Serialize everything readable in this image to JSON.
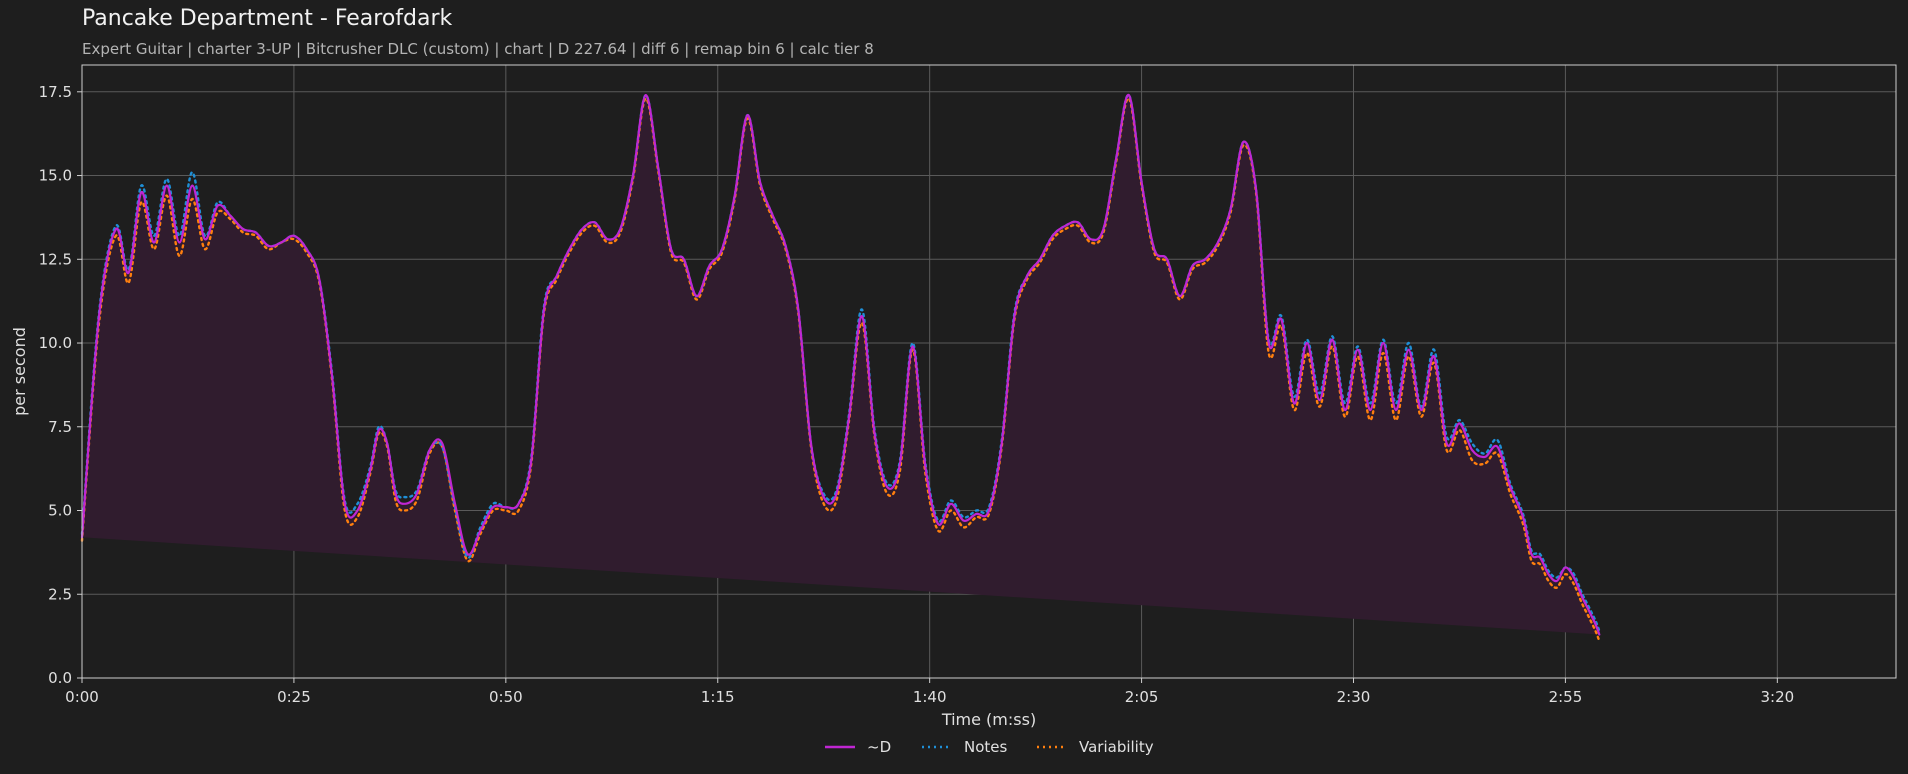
{
  "header": {
    "title": "Pancake Department - Fearofdark",
    "subtitle": "Expert Guitar  |  charter 3-UP  |  Bitcrusher DLC (custom)  |  chart  |  D 227.64  |  diff 6  |  remap bin 6  |  calc tier 8"
  },
  "colors": {
    "background": "#1e1e1e",
    "d_line": "#c026d3",
    "notes_line": "#1f8fd6",
    "variability_line": "#ff7f0e",
    "fill": "#301c2e",
    "grid": "#5a5a5a"
  },
  "chart_data": {
    "type": "line",
    "xlabel": "Time (m:ss)",
    "ylabel": "per second",
    "xlim": [
      0,
      214
    ],
    "ylim": [
      0,
      18.3
    ],
    "grid": true,
    "legend_placement": "bottom-center",
    "x_ticks": [
      {
        "value": 0,
        "label": "0:00"
      },
      {
        "value": 25,
        "label": "0:25"
      },
      {
        "value": 50,
        "label": "0:50"
      },
      {
        "value": 75,
        "label": "1:15"
      },
      {
        "value": 100,
        "label": "1:40"
      },
      {
        "value": 125,
        "label": "2:05"
      },
      {
        "value": 150,
        "label": "2:30"
      },
      {
        "value": 175,
        "label": "2:55"
      },
      {
        "value": 200,
        "label": "3:20"
      }
    ],
    "y_ticks": [
      {
        "value": 0,
        "label": "0.0"
      },
      {
        "value": 2.5,
        "label": "2.5"
      },
      {
        "value": 5,
        "label": "5.0"
      },
      {
        "value": 7.5,
        "label": "7.5"
      },
      {
        "value": 10,
        "label": "10.0"
      },
      {
        "value": 12.5,
        "label": "12.5"
      },
      {
        "value": 15,
        "label": "15.0"
      },
      {
        "value": 17.5,
        "label": "17.5"
      }
    ],
    "x": [
      0,
      2,
      4,
      5.5,
      7,
      8.5,
      10,
      11.5,
      13,
      14.5,
      16,
      17.5,
      19,
      20.5,
      22,
      23.5,
      25,
      26.5,
      28,
      29.5,
      31,
      32.5,
      34,
      35,
      36,
      37,
      38,
      39.5,
      41,
      42.5,
      44,
      45.5,
      47,
      48.5,
      50,
      51.5,
      53,
      54.5,
      56,
      57.5,
      59,
      60.5,
      62,
      63.5,
      65,
      66.5,
      68,
      69.5,
      71,
      72.5,
      74,
      75.5,
      77,
      78.5,
      80,
      81.5,
      83,
      84.5,
      86,
      87.5,
      89,
      90.5,
      92,
      93.5,
      95,
      96.5,
      98,
      99.5,
      101,
      102.5,
      104,
      105.5,
      107,
      108.5,
      110,
      111.5,
      113,
      114.5,
      116,
      117.5,
      119,
      120.5,
      122,
      123.5,
      125,
      126.5,
      128,
      129.5,
      131,
      132.5,
      134,
      135.5,
      137,
      138.5,
      140,
      141.5,
      143,
      144.5,
      146,
      147.5,
      149,
      150.5,
      152,
      153.5,
      155,
      156.5,
      158,
      159.5,
      161,
      162.5,
      164,
      165.5,
      167,
      168.5,
      170,
      171,
      172,
      173,
      174,
      175,
      176,
      177,
      178,
      179,
      180,
      181,
      182,
      183,
      184,
      185,
      186,
      187,
      188,
      189,
      190,
      191,
      192,
      193,
      194,
      195,
      196,
      197,
      198,
      199,
      200,
      201,
      202,
      203,
      204,
      205,
      206,
      207,
      208,
      209,
      210,
      211,
      212,
      213,
      214
    ],
    "series": [
      {
        "name": "~D",
        "values": [
          4.2,
          10.8,
          13.4,
          12.1,
          14.5,
          13.0,
          14.7,
          13.0,
          14.7,
          13.1,
          14.1,
          13.8,
          13.4,
          13.3,
          12.9,
          13.0,
          13.2,
          12.8,
          11.9,
          9.0,
          5.2,
          5.0,
          6.2,
          7.4,
          7.0,
          5.5,
          5.2,
          5.5,
          6.8,
          7.0,
          5.2,
          3.7,
          4.4,
          5.1,
          5.1,
          5.2,
          6.5,
          11.0,
          12.0,
          12.8,
          13.4,
          13.6,
          13.1,
          13.4,
          15.0,
          17.4,
          15.2,
          12.8,
          12.5,
          11.4,
          12.3,
          12.8,
          14.4,
          16.8,
          14.8,
          13.8,
          12.9,
          11.0,
          7.0,
          5.4,
          5.5,
          7.8,
          10.8,
          7.3,
          5.7,
          6.4,
          9.9,
          6.3,
          4.6,
          5.2,
          4.7,
          4.9,
          5.0,
          7.0,
          10.8,
          12.0,
          12.5,
          13.2,
          13.5,
          13.6,
          13.1,
          13.4,
          15.5,
          17.4,
          14.8,
          12.8,
          12.5,
          11.4,
          12.3,
          12.5,
          13.0,
          14.0,
          16.0,
          14.6,
          10.0,
          10.7,
          8.2,
          10.0,
          8.3,
          10.1,
          8.0,
          9.8,
          8.0,
          10.0,
          8.0,
          9.8,
          8.0,
          9.6,
          7.0,
          7.6,
          6.8,
          6.6,
          6.9,
          5.7,
          4.8,
          3.7,
          3.6,
          3.1,
          2.9,
          3.3,
          3.0,
          2.4,
          1.9,
          1.3,
          0.2
        ]
      },
      {
        "name": "Notes",
        "values": [
          4.3,
          10.9,
          13.5,
          12.2,
          14.7,
          13.2,
          14.9,
          13.2,
          15.1,
          13.2,
          14.2,
          13.8,
          13.4,
          13.3,
          12.9,
          13.0,
          13.2,
          12.8,
          11.9,
          9.1,
          5.3,
          5.2,
          6.3,
          7.5,
          7.0,
          5.6,
          5.4,
          5.6,
          6.8,
          6.9,
          5.1,
          3.6,
          4.5,
          5.2,
          5.1,
          5.2,
          6.6,
          11.1,
          12.0,
          12.8,
          13.4,
          13.6,
          13.1,
          13.4,
          15.0,
          17.4,
          15.2,
          12.8,
          12.5,
          11.4,
          12.3,
          12.8,
          14.4,
          16.8,
          14.8,
          13.8,
          12.9,
          11.0,
          7.0,
          5.5,
          5.6,
          7.9,
          11.0,
          7.4,
          5.8,
          6.5,
          10.0,
          6.4,
          4.7,
          5.3,
          4.8,
          5.0,
          5.1,
          7.1,
          10.9,
          12.0,
          12.5,
          13.2,
          13.5,
          13.6,
          13.1,
          13.4,
          15.5,
          17.4,
          14.8,
          12.8,
          12.5,
          11.4,
          12.3,
          12.5,
          13.0,
          14.0,
          16.0,
          14.6,
          10.1,
          10.8,
          8.4,
          10.1,
          8.5,
          10.2,
          8.2,
          9.9,
          8.2,
          10.1,
          8.2,
          10.0,
          8.1,
          9.8,
          7.2,
          7.7,
          7.0,
          6.7,
          7.1,
          5.8,
          4.9,
          3.8,
          3.7,
          3.2,
          3.0,
          3.3,
          3.1,
          2.5,
          2.0,
          1.4,
          0.3
        ]
      },
      {
        "name": "Variability",
        "values": [
          4.1,
          10.6,
          13.2,
          11.8,
          14.2,
          12.8,
          14.4,
          12.6,
          14.3,
          12.8,
          13.9,
          13.7,
          13.3,
          13.2,
          12.8,
          13.0,
          13.1,
          12.7,
          11.8,
          8.9,
          5.0,
          4.8,
          6.1,
          7.3,
          6.9,
          5.3,
          5.0,
          5.3,
          6.7,
          6.9,
          5.0,
          3.5,
          4.3,
          5.0,
          5.0,
          5.0,
          6.4,
          10.9,
          11.9,
          12.7,
          13.3,
          13.5,
          13.0,
          13.3,
          14.9,
          17.3,
          15.1,
          12.7,
          12.4,
          11.3,
          12.2,
          12.7,
          14.3,
          16.7,
          14.7,
          13.7,
          12.8,
          10.9,
          6.9,
          5.2,
          5.3,
          7.7,
          10.6,
          7.2,
          5.5,
          6.2,
          9.8,
          6.1,
          4.4,
          5.0,
          4.5,
          4.8,
          4.9,
          6.9,
          10.7,
          11.9,
          12.4,
          13.1,
          13.4,
          13.5,
          13.0,
          13.3,
          15.4,
          17.3,
          14.7,
          12.7,
          12.4,
          11.3,
          12.2,
          12.4,
          12.9,
          13.9,
          15.9,
          14.5,
          9.7,
          10.5,
          8.0,
          9.7,
          8.1,
          9.9,
          7.8,
          9.6,
          7.7,
          9.7,
          7.7,
          9.6,
          7.8,
          9.4,
          6.8,
          7.4,
          6.5,
          6.4,
          6.7,
          5.5,
          4.6,
          3.5,
          3.4,
          2.9,
          2.7,
          3.1,
          2.8,
          2.2,
          1.7,
          1.1,
          0.1
        ]
      }
    ]
  }
}
